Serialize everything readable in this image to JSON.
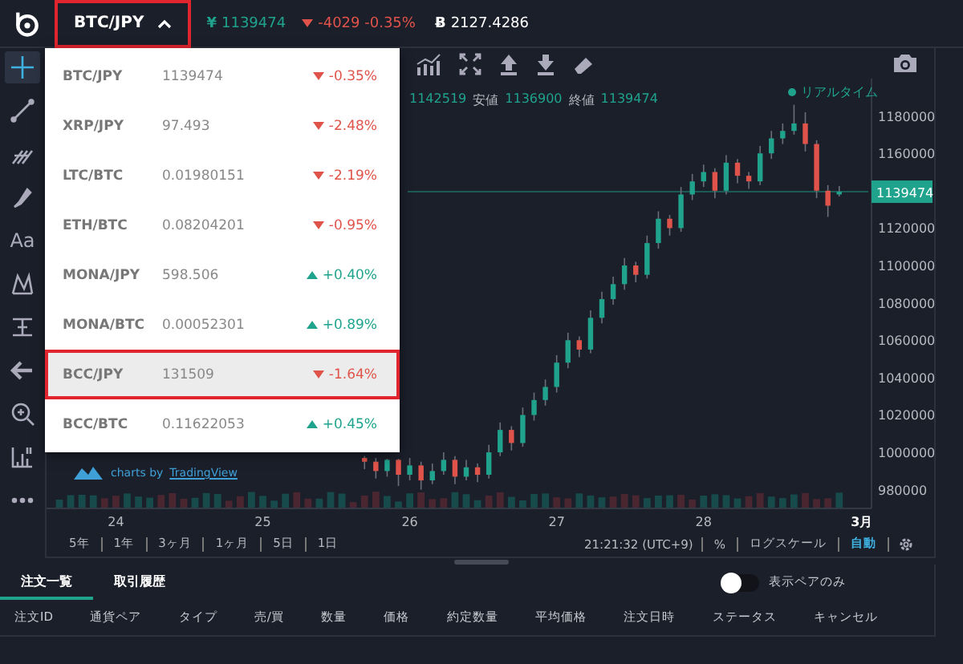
{
  "header": {
    "pair": "BTC/JPY",
    "pair_highlighted": true,
    "price_symbol": "¥",
    "last_price": "1139474",
    "change": "-4029 -0.35%",
    "change_up": false,
    "balance_symbol": "Ƀ",
    "balance": "2127.4286"
  },
  "left_tools": [
    {
      "kind": "crosshair",
      "selected": true
    },
    {
      "kind": "line",
      "selected": false
    },
    {
      "kind": "fork",
      "selected": false
    },
    {
      "kind": "brush",
      "selected": false
    },
    {
      "kind": "text",
      "label": "Aa",
      "selected": false
    },
    {
      "kind": "pattern",
      "selected": false
    },
    {
      "kind": "measure",
      "selected": false
    },
    {
      "kind": "arrow",
      "selected": false
    },
    {
      "kind": "zoom",
      "selected": false
    },
    {
      "kind": "ruler",
      "selected": false
    },
    {
      "kind": "more",
      "selected": false
    }
  ],
  "pair_menu": [
    {
      "pair": "BTC/JPY",
      "price": "1139474",
      "change": "-0.35%",
      "up": false,
      "highlighted": false
    },
    {
      "pair": "XRP/JPY",
      "price": "97.493",
      "change": "-2.48%",
      "up": false,
      "highlighted": false
    },
    {
      "pair": "LTC/BTC",
      "price": "0.01980151",
      "change": "-2.19%",
      "up": false,
      "highlighted": false
    },
    {
      "pair": "ETH/BTC",
      "price": "0.08204201",
      "change": "-0.95%",
      "up": false,
      "highlighted": false
    },
    {
      "pair": "MONA/JPY",
      "price": "598.506",
      "change": "+0.40%",
      "up": true,
      "highlighted": false
    },
    {
      "pair": "MONA/BTC",
      "price": "0.00052301",
      "change": "+0.89%",
      "up": true,
      "highlighted": false
    },
    {
      "pair": "BCC/JPY",
      "price": "131509",
      "change": "-1.64%",
      "up": false,
      "highlighted": true
    },
    {
      "pair": "BCC/BTC",
      "price": "0.11622053",
      "change": "+0.45%",
      "up": true,
      "highlighted": false
    }
  ],
  "chart": {
    "legend": [
      {
        "value": "1142519"
      },
      {
        "label": "安値",
        "value": "1136900"
      },
      {
        "label": "終値",
        "value": "1139474"
      }
    ],
    "realtime": "リアルタイム",
    "current_price": "1139474",
    "chart_data": {
      "type": "candlestick",
      "ylim": [
        970000,
        1200000
      ],
      "categories": [
        null,
        null,
        null,
        null,
        null,
        "24",
        null,
        null,
        null,
        null,
        null,
        null,
        null,
        null,
        null,
        null,
        null,
        null,
        "25",
        null,
        null,
        null,
        null,
        null,
        null,
        null,
        null,
        null,
        null,
        null,
        null,
        "26",
        null,
        null,
        null,
        null,
        null,
        null,
        null,
        null,
        null,
        null,
        null,
        null,
        "27",
        null,
        null,
        null,
        null,
        null,
        null,
        null,
        null,
        null,
        null,
        null,
        null,
        "28",
        null,
        null,
        null,
        null,
        null,
        null,
        null,
        null,
        null,
        null,
        null,
        null,
        null,
        "3月"
      ],
      "yticks": [
        1180000,
        1160000,
        1120000,
        1100000,
        1080000,
        1060000,
        1040000,
        1020000,
        1000000,
        980000
      ],
      "ohlc": [
        null,
        null,
        null,
        null,
        null,
        null,
        null,
        null,
        null,
        null,
        null,
        null,
        null,
        null,
        null,
        null,
        null,
        null,
        null,
        null,
        null,
        null,
        null,
        null,
        null,
        null,
        null,
        [
          997000,
          998000,
          991000,
          995000
        ],
        [
          995000,
          997000,
          986000,
          990000
        ],
        [
          990000,
          996500,
          987000,
          996000
        ],
        [
          996000,
          996500,
          982000,
          988000
        ],
        [
          988000,
          997000,
          985000,
          993000
        ],
        [
          993000,
          995000,
          980000,
          985000
        ],
        [
          985000,
          994000,
          983000,
          990000
        ],
        [
          990000,
          1000000,
          988000,
          996000
        ],
        [
          996000,
          998000,
          983000,
          987000
        ],
        [
          987000,
          996000,
          985000,
          992000
        ],
        [
          992000,
          994000,
          984000,
          988000
        ],
        [
          988000,
          1004000,
          986000,
          1000000
        ],
        [
          1000000,
          1016000,
          998000,
          1012000
        ],
        [
          1012000,
          1014000,
          1001000,
          1005000
        ],
        [
          1005000,
          1024000,
          1003000,
          1020000
        ],
        [
          1020000,
          1032000,
          1017000,
          1028000
        ],
        [
          1028000,
          1039000,
          1025000,
          1035000
        ],
        [
          1035000,
          1052000,
          1032000,
          1048000
        ],
        [
          1048000,
          1064000,
          1045000,
          1060000
        ],
        [
          1060000,
          1062000,
          1051000,
          1055000
        ],
        [
          1055000,
          1076000,
          1053000,
          1072000
        ],
        [
          1072000,
          1086000,
          1069000,
          1082000
        ],
        [
          1082000,
          1094000,
          1079000,
          1090000
        ],
        [
          1090000,
          1104000,
          1087000,
          1100000
        ],
        [
          1100000,
          1102000,
          1091000,
          1095000
        ],
        [
          1095000,
          1116000,
          1093000,
          1112000
        ],
        [
          1112000,
          1129000,
          1109000,
          1125000
        ],
        [
          1125000,
          1127000,
          1116000,
          1120000
        ],
        [
          1120000,
          1142000,
          1118000,
          1138000
        ],
        [
          1138000,
          1149000,
          1135000,
          1145000
        ],
        [
          1145000,
          1154000,
          1142000,
          1150000
        ],
        [
          1150000,
          1152000,
          1136000,
          1140000
        ],
        [
          1140000,
          1159000,
          1138000,
          1155000
        ],
        [
          1155000,
          1157000,
          1144000,
          1148000
        ],
        [
          1148000,
          1150000,
          1141000,
          1145000
        ],
        [
          1145000,
          1164000,
          1143000,
          1160000
        ],
        [
          1160000,
          1172000,
          1157000,
          1168000
        ],
        [
          1168000,
          1176000,
          1165000,
          1172000
        ],
        [
          1172000,
          1186000,
          1170000,
          1176000
        ],
        [
          1176000,
          1182000,
          1161000,
          1165000
        ],
        [
          1165000,
          1167000,
          1136000,
          1140000
        ],
        [
          1140000,
          1143000,
          1126000,
          1132000
        ],
        [
          1138000,
          1142519,
          1136900,
          1139474
        ],
        null,
        null
      ]
    },
    "attribution": {
      "text": "charts by",
      "link": "TradingView"
    },
    "ranges": [
      "5年",
      "1年",
      "3ヶ月",
      "1ヶ月",
      "5日",
      "1日"
    ],
    "clock": "21:21:32 (UTC+9)",
    "scale_options": [
      {
        "label": "%",
        "selected": false
      },
      {
        "label": "ログスケール",
        "selected": false
      },
      {
        "label": "自動",
        "selected": true
      }
    ]
  },
  "orders": {
    "tabs": [
      {
        "label": "注文一覧",
        "selected": true
      },
      {
        "label": "取引履歴",
        "selected": false
      }
    ],
    "filter": {
      "label": "表示ペアのみ",
      "on": false
    },
    "columns": [
      "注文ID",
      "通貨ペア",
      "タイプ",
      "売/買",
      "数量",
      "価格",
      "約定数量",
      "平均価格",
      "注文日時",
      "ステータス",
      "キャンセル"
    ]
  }
}
